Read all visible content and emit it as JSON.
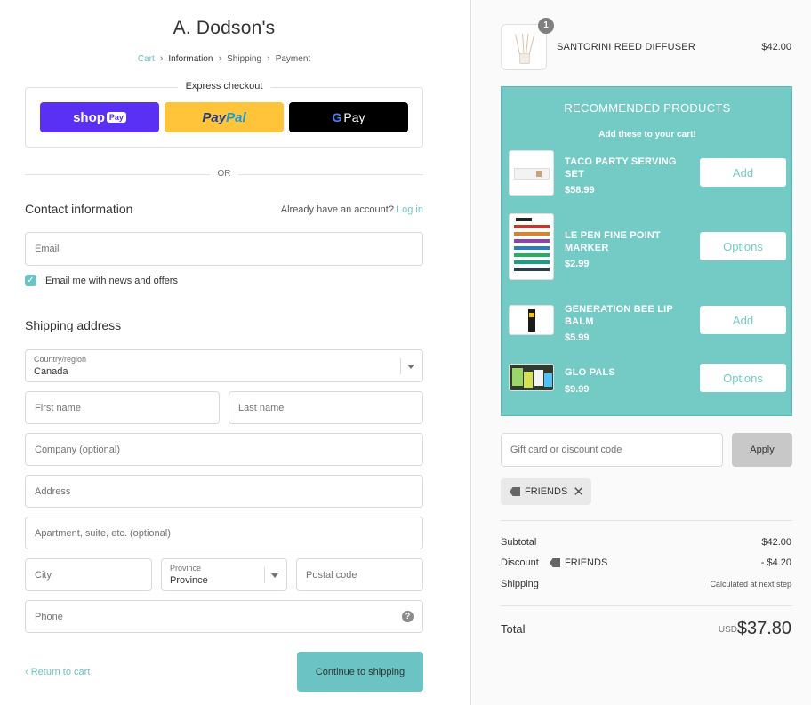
{
  "shop": {
    "title": "A. Dodson's"
  },
  "breadcrumb": {
    "cart": "Cart",
    "information": "Information",
    "shipping": "Shipping",
    "payment": "Payment"
  },
  "express": {
    "title": "Express checkout",
    "shop_pay": "shop",
    "shop_pay_box": "Pay",
    "paypal_pay": "Pay",
    "paypal_pal": "Pal",
    "gpay_g": "G",
    "gpay_pay": "Pay",
    "or": "OR"
  },
  "contact": {
    "title": "Contact information",
    "account_prompt": "Already have an account?",
    "login": "Log in",
    "email_placeholder": "Email",
    "newsletter_label": "Email me with news and offers",
    "newsletter_checked": true
  },
  "shipping": {
    "title": "Shipping address",
    "country_label": "Country/region",
    "country_value": "Canada",
    "first_name": "First name",
    "last_name": "Last name",
    "company": "Company (optional)",
    "address": "Address",
    "apartment": "Apartment, suite, etc. (optional)",
    "city": "City",
    "province_label": "Province",
    "province_value": "Province",
    "postal": "Postal code",
    "phone": "Phone"
  },
  "actions": {
    "return": "Return to cart",
    "return_icon": "chevron-left-icon",
    "continue": "Continue to shipping"
  },
  "cart": {
    "item_name": "SANTORINI REED DIFFUSER",
    "item_price": "$42.00",
    "quantity": "1"
  },
  "recommended": {
    "title": "RECOMMENDED PRODUCTS",
    "subtitle": "Add these to your cart!",
    "items": [
      {
        "name": "TACO PARTY SERVING SET",
        "price": "$58.99",
        "button": "Add"
      },
      {
        "name": "LE PEN FINE POINT MARKER",
        "price": "$2.99",
        "button": "Options"
      },
      {
        "name": "GENERATION BEE LIP BALM",
        "price": "$5.99",
        "button": "Add"
      },
      {
        "name": "GLO PALS",
        "price": "$9.99",
        "button": "Options"
      }
    ]
  },
  "discount": {
    "placeholder": "Gift card or discount code",
    "apply": "Apply",
    "applied_code": "FRIENDS"
  },
  "summary": {
    "subtotal_label": "Subtotal",
    "subtotal_value": "$42.00",
    "discount_label": "Discount",
    "discount_code": "FRIENDS",
    "discount_value": "- $4.20",
    "shipping_label": "Shipping",
    "shipping_value": "Calculated at next step",
    "total_label": "Total",
    "currency": "USD",
    "total_value": "$37.80"
  },
  "colors": {
    "accent": "#6cc3c3",
    "recommend_bg": "#74cbc6",
    "shop_pay": "#5a31f4",
    "paypal": "#ffc439"
  }
}
